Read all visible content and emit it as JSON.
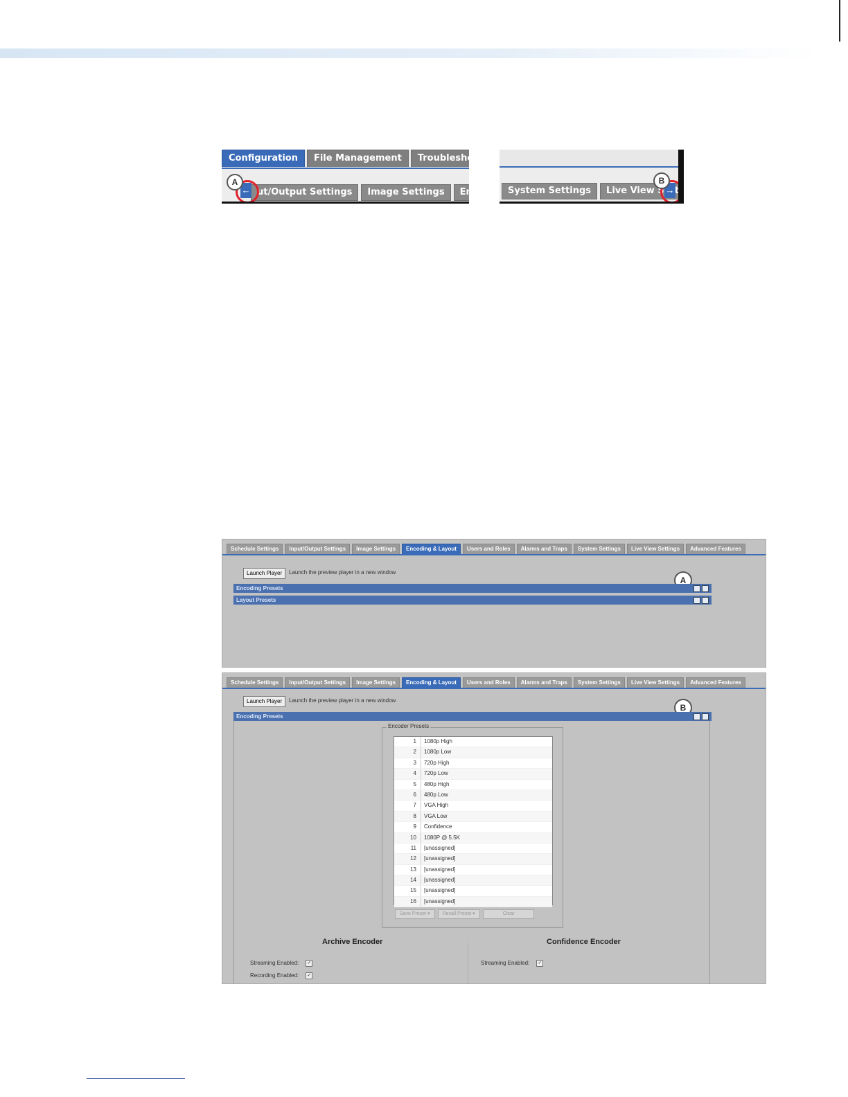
{
  "top_screenshot_left": {
    "main_tabs": [
      "Configuration",
      "File Management",
      "Troubleshooting"
    ],
    "sub_tabs": [
      "ut/Output Settings",
      "Image Settings",
      "Encodin"
    ],
    "callout": "A",
    "scroll_icon": "arrow-left-icon",
    "scroll_glyph": "←"
  },
  "top_screenshot_right": {
    "sub_tabs": [
      "System Settings",
      "Live View Setti"
    ],
    "callout": "B",
    "scroll_icon": "arrow-right-icon",
    "scroll_glyph": "→"
  },
  "app": {
    "tabs": [
      "Schedule Settings",
      "Input/Output Settings",
      "Image Settings",
      "Encoding & Layout",
      "Users and Roles",
      "Alarms and Traps",
      "System Settings",
      "Live View Settings",
      "Advanced Features"
    ],
    "launch_button": "Launch Player",
    "launch_text": "Launch the preview player in a new window"
  },
  "screenshot_collapsed": {
    "callout": "A",
    "panels": [
      "Encoding Presets",
      "Layout Presets"
    ]
  },
  "screenshot_expanded": {
    "callout": "B",
    "panel": "Encoding Presets",
    "fieldset_legend": "Encoder Presets",
    "presets": [
      {
        "num": "1",
        "name": "1080p High"
      },
      {
        "num": "2",
        "name": "1080p Low"
      },
      {
        "num": "3",
        "name": "720p High"
      },
      {
        "num": "4",
        "name": "720p Low"
      },
      {
        "num": "5",
        "name": "480p High"
      },
      {
        "num": "6",
        "name": "480p Low"
      },
      {
        "num": "7",
        "name": "VGA High"
      },
      {
        "num": "8",
        "name": "VGA Low"
      },
      {
        "num": "9",
        "name": "Confidence"
      },
      {
        "num": "10",
        "name": "1080P @ 5.5K"
      },
      {
        "num": "11",
        "name": "[unassigned]"
      },
      {
        "num": "12",
        "name": "[unassigned]"
      },
      {
        "num": "13",
        "name": "[unassigned]"
      },
      {
        "num": "14",
        "name": "[unassigned]"
      },
      {
        "num": "15",
        "name": "[unassigned]"
      },
      {
        "num": "16",
        "name": "[unassigned]"
      }
    ],
    "preset_buttons": [
      "Save Preset ▾",
      "Recall Preset ▾",
      "Clear"
    ],
    "archive": {
      "title": "Archive Encoder",
      "streaming": "Streaming Enabled:",
      "recording": "Recording Enabled:"
    },
    "confidence": {
      "title": "Confidence Encoder",
      "streaming": "Streaming Enabled:"
    },
    "check_glyph": "✓"
  }
}
